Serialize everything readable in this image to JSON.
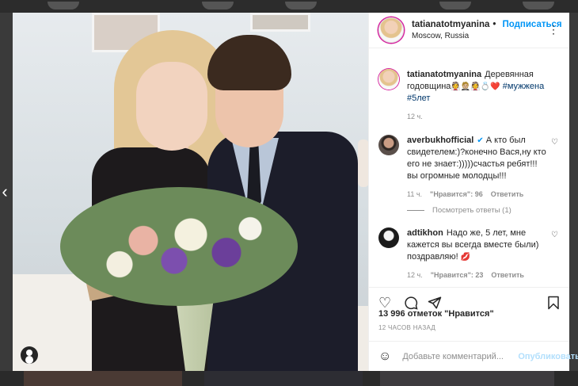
{
  "post": {
    "username": "tatianatotmyanina",
    "follow_label": "Подписаться",
    "location": "Moscow, Russia",
    "caption_user": "tatianatotmyanina",
    "caption_text": "Деревянная годовщина",
    "caption_emojis": "👰🤵🏼👰💍❤️",
    "caption_tags": "#мужжена #5лет",
    "caption_time": "12 ч."
  },
  "comments": [
    {
      "user": "averbukhofficial",
      "text": "А кто был свидетелем:)?конечно Вася,ну кто его не знает:)))))счастья ребят!!!вы огромные молодцы!!!",
      "time": "11 ч.",
      "likes": "\"Нравится\": 96",
      "reply_label": "Ответить",
      "view_replies": "Посмотреть ответы (1)"
    },
    {
      "user": "adtikhon",
      "text": "Надо же, 5 лет, мне кажется вы всегда вместе были) поздравляю!",
      "emoji": "💋",
      "time": "12 ч.",
      "likes": "\"Нравится\": 23",
      "reply_label": "Ответить"
    }
  ],
  "footer": {
    "likes_text": "13 996 отметок \"Нравится\"",
    "ago": "12 ЧАСОВ НАЗАД",
    "comment_placeholder": "Добавьте комментарий...",
    "publish_label": "Опубликовать"
  },
  "icons": {
    "like": "heart-icon",
    "comment": "comment-icon",
    "share": "share-icon",
    "save": "bookmark-icon"
  },
  "colors": {
    "accent": "#0095f6",
    "hashtag": "#00376b",
    "muted": "#8e8e8e"
  }
}
